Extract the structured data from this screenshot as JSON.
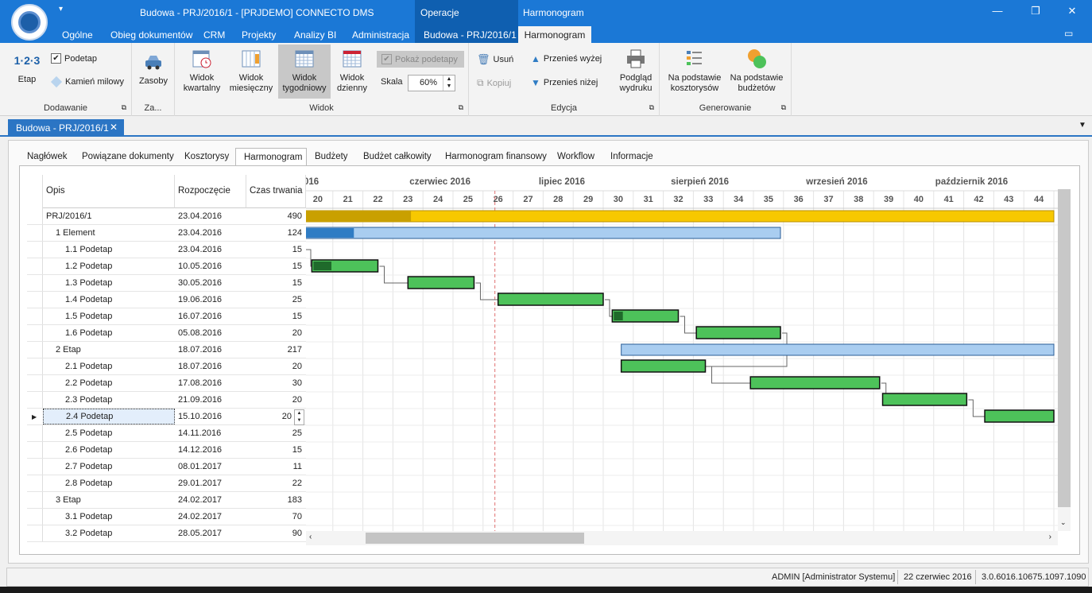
{
  "app": {
    "title": "Budowa - PRJ/2016/1 - [PRJDEMO] CONNECTO DMS",
    "context_group": "Operacje",
    "context_title": "Harmonogram",
    "quick_access": "▾"
  },
  "window": {
    "minimize": "—",
    "restore": "❐",
    "close": "✕"
  },
  "menu_tabs": [
    "Ogólne",
    "Obieg dokumentów",
    "CRM",
    "Projekty",
    "Analizy BI",
    "Administracja",
    "Budowa - PRJ/2016/1",
    "Harmonogram"
  ],
  "ribbon": {
    "etap_label": "Etap",
    "etap_icon_text": "1·2·3",
    "podetap_label": "Podetap",
    "kamien_label": "Kamień milowy",
    "dodawanie_label": "Dodawanie",
    "zasoby_label": "Zasoby",
    "za_label": "Za...",
    "kwartalny": [
      "Widok",
      "kwartalny"
    ],
    "miesieczny": [
      "Widok",
      "miesięczny"
    ],
    "tygodniowy": [
      "Widok",
      "tygodniowy"
    ],
    "dzienny": [
      "Widok",
      "dzienny"
    ],
    "pokaz_podetapy": "Pokaż podetapy",
    "skala_label": "Skala",
    "skala_value": "60%",
    "widok_label": "Widok",
    "usun": "Usuń",
    "kopiuj": "Kopiuj",
    "przenies_wyzej": "Przenieś wyżej",
    "przenies_nizej": "Przenieś niżej",
    "podglad": [
      "Podgląd",
      "wydruku"
    ],
    "edycja_label": "Edycja",
    "na_koszt": [
      "Na podstawie",
      "kosztorysów"
    ],
    "na_budzet": [
      "Na podstawie",
      "budżetów"
    ],
    "generowanie_label": "Generowanie"
  },
  "doc_tab": {
    "label": "Budowa - PRJ/2016/1",
    "close": "✕"
  },
  "inner_tabs": [
    "Nagłówek",
    "Powiązane dokumenty",
    "Kosztorysy",
    "Harmonogram",
    "Budżety",
    "Budżet całkowity",
    "Harmonogram finansowy",
    "Workflow",
    "Informacje"
  ],
  "grid": {
    "headers": [
      "Opis",
      "Rozpoczęcie",
      "Czas trwania"
    ],
    "rows": [
      {
        "opis": "PRJ/2016/1",
        "start": "23.04.2016",
        "dur": "490",
        "level": 0
      },
      {
        "opis": "1 Element",
        "start": "23.04.2016",
        "dur": "124",
        "level": 1
      },
      {
        "opis": "1.1 Podetap",
        "start": "23.04.2016",
        "dur": "15",
        "level": 2
      },
      {
        "opis": "1.2 Podetap",
        "start": "10.05.2016",
        "dur": "15",
        "level": 2
      },
      {
        "opis": "1.3 Podetap",
        "start": "30.05.2016",
        "dur": "15",
        "level": 2
      },
      {
        "opis": "1.4 Podetap",
        "start": "19.06.2016",
        "dur": "25",
        "level": 2
      },
      {
        "opis": "1.5 Podetap",
        "start": "16.07.2016",
        "dur": "15",
        "level": 2
      },
      {
        "opis": "1.6 Podetap",
        "start": "05.08.2016",
        "dur": "20",
        "level": 2
      },
      {
        "opis": "2 Etap",
        "start": "18.07.2016",
        "dur": "217",
        "level": 1
      },
      {
        "opis": "2.1 Podetap",
        "start": "18.07.2016",
        "dur": "20",
        "level": 2
      },
      {
        "opis": "2.2 Podetap",
        "start": "17.08.2016",
        "dur": "30",
        "level": 2
      },
      {
        "opis": "2.3 Podetap",
        "start": "21.09.2016",
        "dur": "20",
        "level": 2
      },
      {
        "opis": "2.4 Podetap",
        "start": "15.10.2016",
        "dur": "20",
        "level": 2,
        "selected": true
      },
      {
        "opis": "2.5 Podetap",
        "start": "14.11.2016",
        "dur": "25",
        "level": 2
      },
      {
        "opis": "2.6 Podetap",
        "start": "14.12.2016",
        "dur": "15",
        "level": 2
      },
      {
        "opis": "2.7 Podetap",
        "start": "08.01.2017",
        "dur": "11",
        "level": 2
      },
      {
        "opis": "2.8 Podetap",
        "start": "29.01.2017",
        "dur": "22",
        "level": 2
      },
      {
        "opis": "3 Etap",
        "start": "24.02.2017",
        "dur": "183",
        "level": 1
      },
      {
        "opis": "3.1 Podetap",
        "start": "24.02.2017",
        "dur": "70",
        "level": 2
      },
      {
        "opis": "3.2 Podetap",
        "start": "28.05.2017",
        "dur": "90",
        "level": 2
      }
    ]
  },
  "gantt": {
    "months": [
      {
        "label": "016",
        "week": 19
      },
      {
        "label": "czerwiec 2016",
        "week": 23
      },
      {
        "label": "lipiec 2016",
        "week": 27.3
      },
      {
        "label": "sierpień 2016",
        "week": 31.7
      },
      {
        "label": "wrzesień 2016",
        "week": 36.2
      },
      {
        "label": "październik 2016",
        "week": 40.5
      }
    ],
    "weeks": [
      20,
      21,
      22,
      23,
      24,
      25,
      26,
      27,
      28,
      29,
      30,
      31,
      32,
      33,
      34,
      35,
      36,
      37,
      38,
      39,
      40,
      41,
      42,
      43,
      44
    ],
    "first_week": 19.5,
    "today_week": 26,
    "bars": [
      {
        "row": 0,
        "type": "project",
        "from": 19,
        "to": 44.5,
        "progress_to": 23.1
      },
      {
        "row": 1,
        "type": "stage",
        "from": 19,
        "to": 35.4,
        "progress_to": 21.2
      },
      {
        "row": 3,
        "type": "task",
        "from": 19.8,
        "to": 22,
        "progress_to": 20.4
      },
      {
        "row": 4,
        "type": "task",
        "from": 23,
        "to": 25.2,
        "progress_to": 0
      },
      {
        "row": 5,
        "type": "task",
        "from": 26,
        "to": 29.5,
        "progress_to": 0
      },
      {
        "row": 6,
        "type": "task",
        "from": 29.8,
        "to": 32,
        "progress_to": 30.1
      },
      {
        "row": 7,
        "type": "task",
        "from": 32.6,
        "to": 35.4,
        "progress_to": 0
      },
      {
        "row": 8,
        "type": "stage",
        "from": 30.1,
        "to": 44.5,
        "progress_to": 0
      },
      {
        "row": 9,
        "type": "task",
        "from": 30.1,
        "to": 32.9,
        "progress_to": 0
      },
      {
        "row": 10,
        "type": "task",
        "from": 34.4,
        "to": 38.7,
        "progress_to": 0
      },
      {
        "row": 11,
        "type": "task",
        "from": 38.8,
        "to": 41.6,
        "progress_to": 0
      },
      {
        "row": 12,
        "type": "task",
        "from": 42.2,
        "to": 44.5,
        "progress_to": 0
      }
    ]
  },
  "status": {
    "user": "ADMIN [Administrator Systemu]",
    "date": "22 czerwiec 2016",
    "version": "3.0.6016.10675.1097.1090"
  },
  "colors": {
    "brand": "#1b78d6",
    "project_bar": "#f7c800",
    "project_progress": "#c9a000",
    "stage_bar": "#a9cdf0",
    "stage_progress": "#2f7cc4",
    "task_bar": "#4dc25a",
    "task_progress": "#1f6a2b"
  }
}
